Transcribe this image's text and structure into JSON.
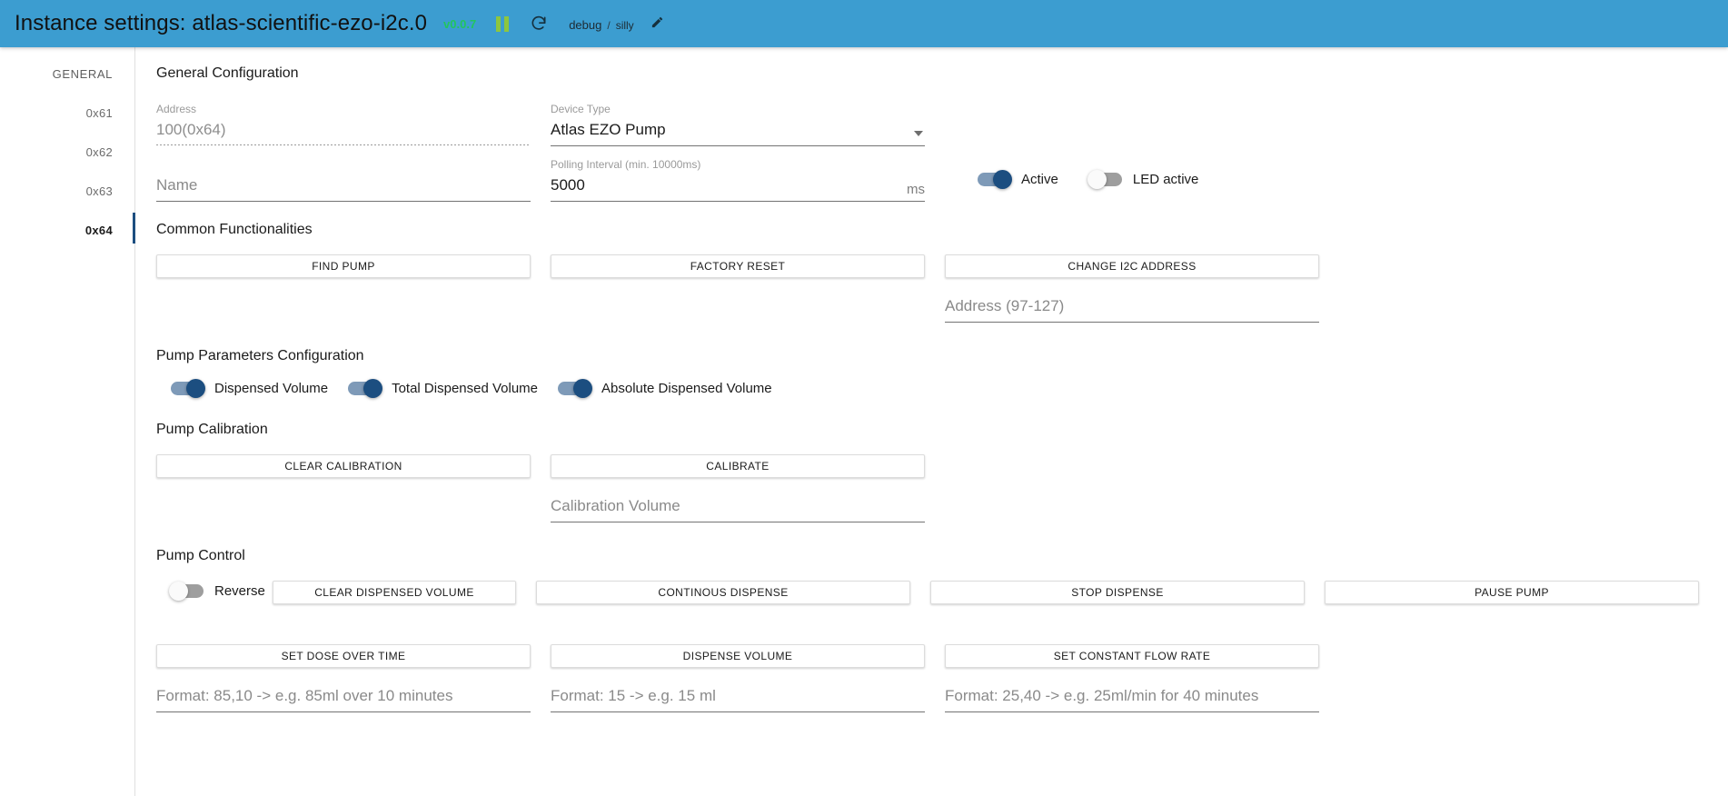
{
  "appbar": {
    "title": "Instance settings: atlas-scientific-ezo-i2c.0",
    "version": "v0.0.7",
    "pause_icon": "pause-icon",
    "refresh_icon": "refresh-icon",
    "log_source": "debug",
    "log_separator": "/",
    "log_level": "silly",
    "edit_icon": "pencil-icon",
    "background_color": "#3c9dd0",
    "version_color": "#22c55e"
  },
  "sidebar": {
    "header": "GENERAL",
    "items": [
      {
        "label": "0x61",
        "active": false
      },
      {
        "label": "0x62",
        "active": false
      },
      {
        "label": "0x63",
        "active": false
      },
      {
        "label": "0x64",
        "active": true
      }
    ],
    "active_indicator_color": "#1c4e80"
  },
  "general": {
    "title": "General Configuration",
    "address": {
      "label": "Address",
      "value": "100(0x64)",
      "disabled": true
    },
    "name": {
      "label": "",
      "placeholder": "Name",
      "value": ""
    },
    "device_type": {
      "label": "Device Type",
      "value": "Atlas EZO Pump",
      "caret": "chevron-down-icon"
    },
    "polling_interval": {
      "label": "Polling Interval (min. 10000ms)",
      "value": "5000",
      "suffix": "ms"
    },
    "active_toggle": {
      "label": "Active",
      "state": "on"
    },
    "led_toggle": {
      "label": "LED active",
      "state": "off"
    }
  },
  "common": {
    "title": "Common Functionalities",
    "find_pump": "FIND PUMP",
    "factory_reset": "FACTORY RESET",
    "change_address": "CHANGE I2C ADDRESS",
    "address_input_placeholder": "Address (97-127)"
  },
  "pump_params": {
    "title": "Pump Parameters Configuration",
    "toggles": [
      {
        "label": "Dispensed Volume",
        "state": "on"
      },
      {
        "label": "Total Dispensed Volume",
        "state": "on"
      },
      {
        "label": "Absolute Dispensed Volume",
        "state": "on"
      }
    ]
  },
  "calibration": {
    "title": "Pump Calibration",
    "clear_calibration": "CLEAR CALIBRATION",
    "calibrate": "CALIBRATE",
    "calibration_volume_placeholder": "Calibration Volume"
  },
  "pump_control": {
    "title": "Pump Control",
    "reverse_toggle": {
      "label": "Reverse",
      "state": "off"
    },
    "clear_dispensed_volume": "CLEAR DISPENSED VOLUME",
    "continous_dispense": "CONTINOUS DISPENSE",
    "stop_dispense": "STOP DISPENSE",
    "pause_pump": "PAUSE PUMP",
    "set_dose_over_time": "SET DOSE OVER TIME",
    "dispense_volume": "DISPENSE VOLUME",
    "set_constant_flow_rate": "SET CONSTANT FLOW RATE",
    "dose_format_placeholder": "Format: 85,10 -> e.g. 85ml over 10 minutes",
    "volume_format_placeholder": "Format: 15 -> e.g. 15 ml",
    "flow_format_placeholder": "Format: 25,40 -> e.g. 25ml/min for 40 minutes"
  }
}
